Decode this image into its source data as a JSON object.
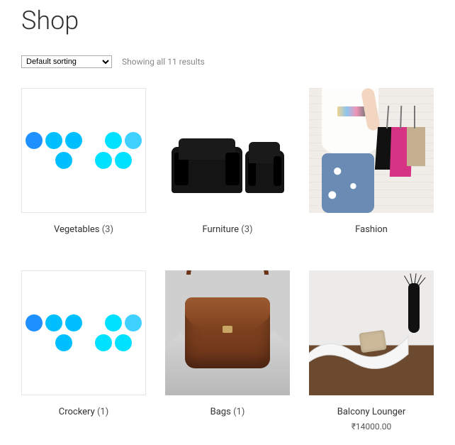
{
  "page": {
    "title": "Shop"
  },
  "toolbar": {
    "sort_selected": "Default sorting",
    "result_text": "Showing all 11 results"
  },
  "items": [
    {
      "name": "Vegetables",
      "count": "(3)"
    },
    {
      "name": "Furniture",
      "count": "(3)"
    },
    {
      "name": "Fashion",
      "count": ""
    },
    {
      "name": "Crockery",
      "count": "(1)"
    },
    {
      "name": "Bags",
      "count": "(1)"
    },
    {
      "name": "Balcony Lounger",
      "count": "",
      "price": "₹14000.00"
    }
  ]
}
